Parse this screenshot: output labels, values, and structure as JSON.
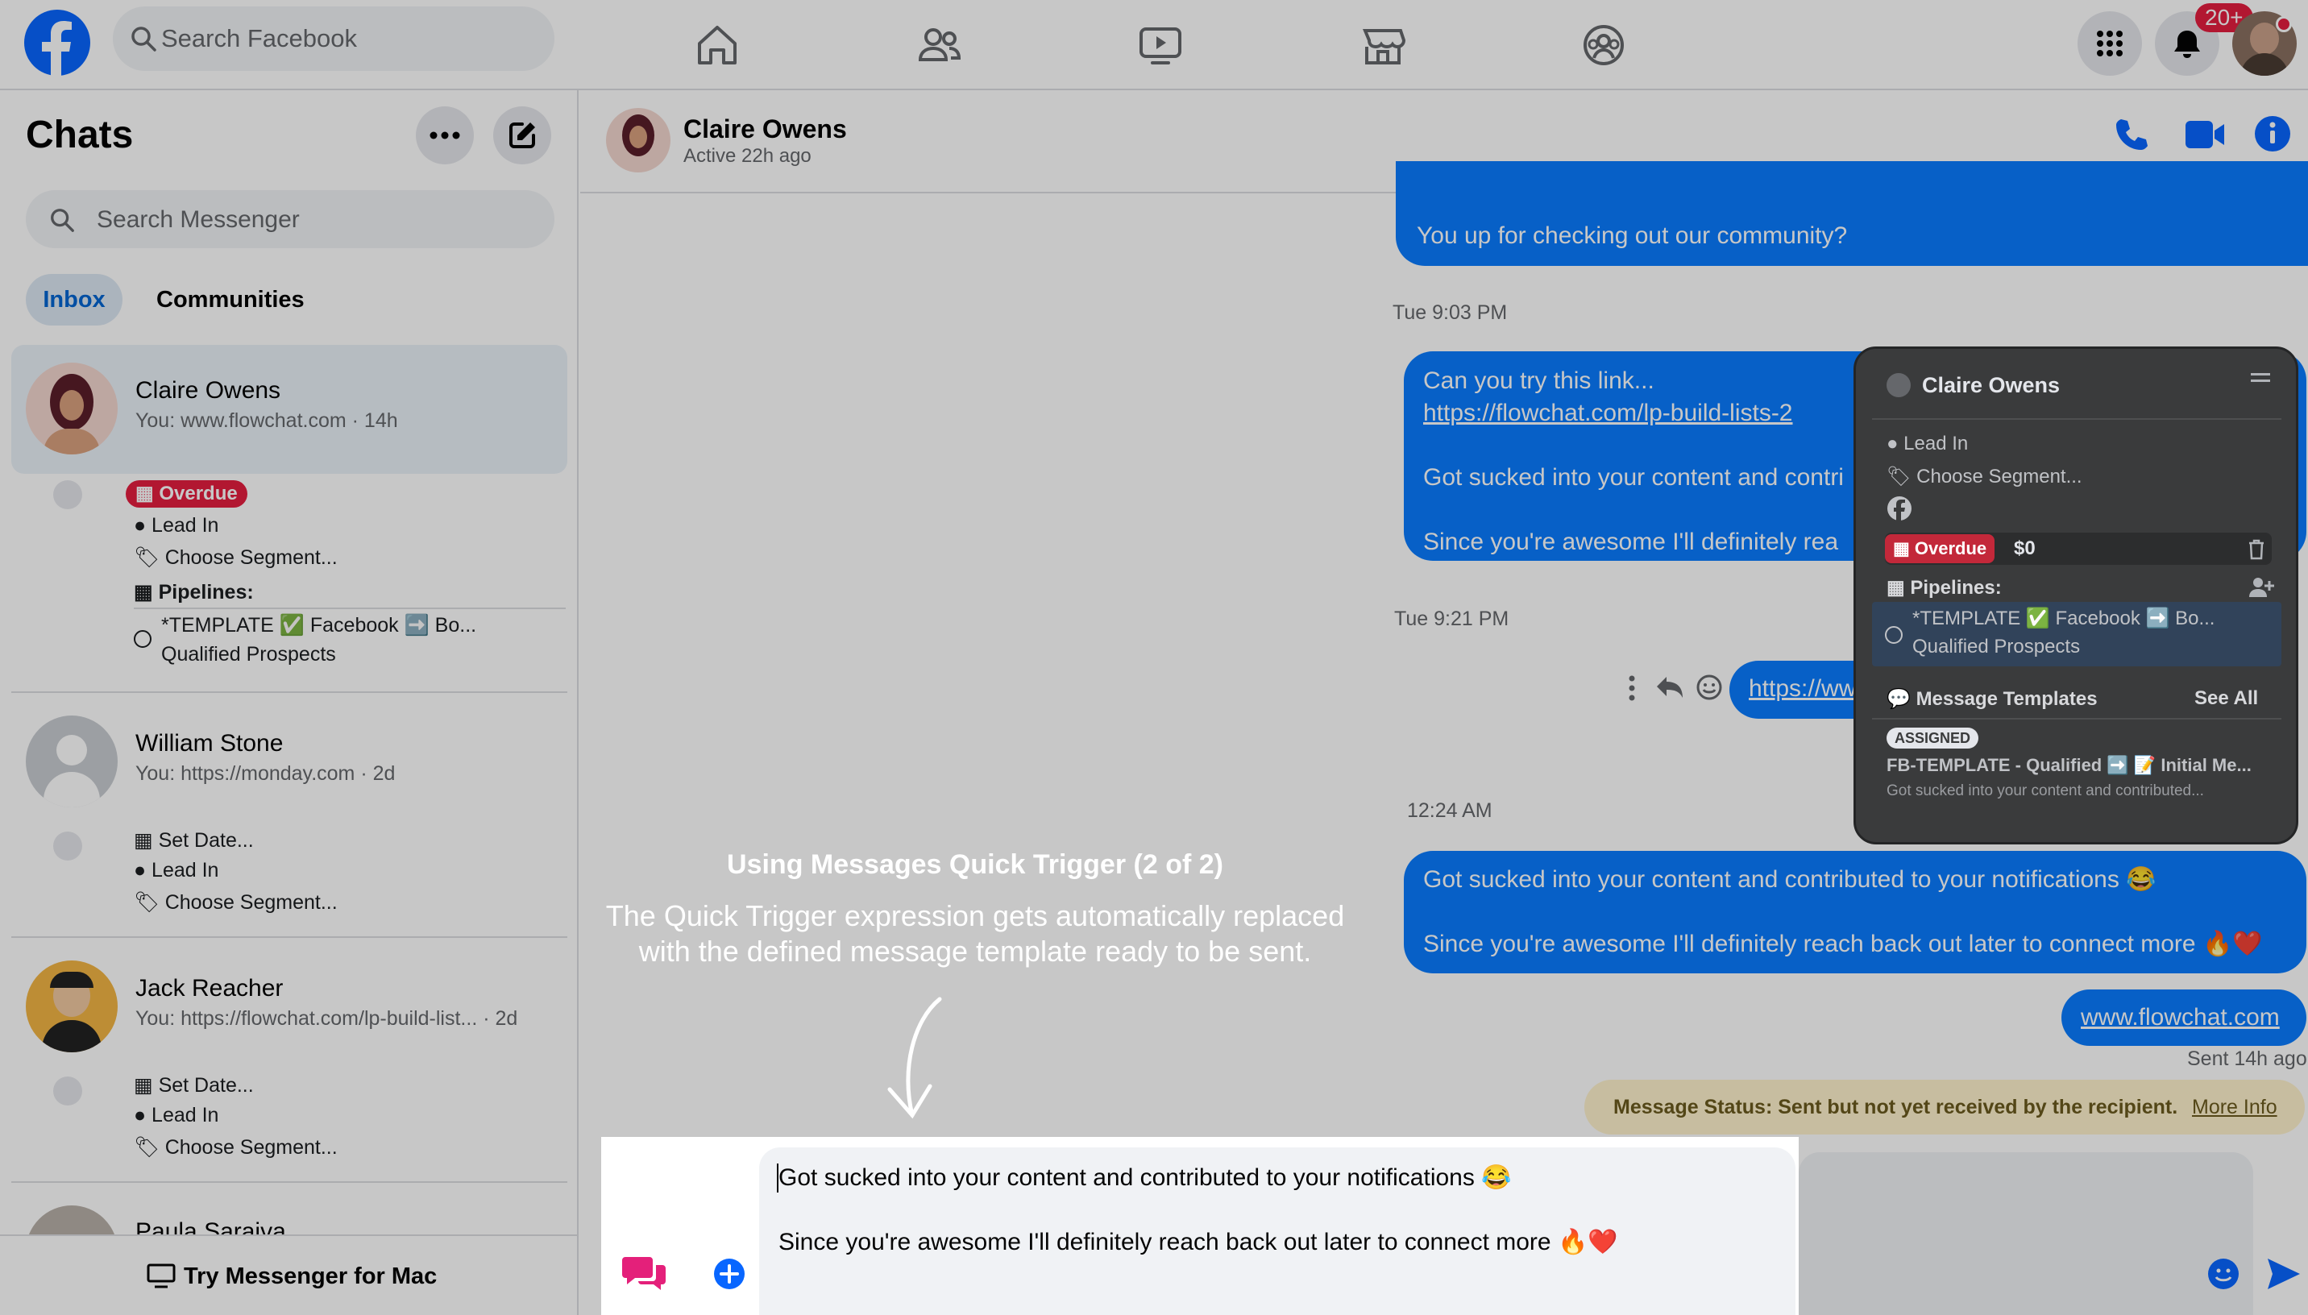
{
  "topbar": {
    "search_placeholder": "Search Facebook",
    "notif_badge": "20+",
    "icons": [
      "home-icon",
      "friends-icon",
      "watch-icon",
      "marketplace-icon",
      "groups-icon",
      "apps-menu-icon",
      "bell-icon"
    ]
  },
  "sidebar": {
    "title": "Chats",
    "search_placeholder": "Search Messenger",
    "tabs": [
      "Inbox",
      "Communities"
    ],
    "try_mac": "Try Messenger for Mac",
    "chats": [
      {
        "name": "Claire Owens",
        "preview": "You: www.flowchat.com · 14h",
        "badge": "Overdue",
        "lead": "Lead In",
        "segment": "Choose Segment...",
        "pipelines": "Pipelines:",
        "pipeline_line1": "*TEMPLATE ✅ Facebook ➡️ Bo...",
        "pipeline_line2": "Qualified Prospects"
      },
      {
        "name": "William Stone",
        "preview": "You: https://monday.com · 2d",
        "date": "Set Date...",
        "lead": "Lead In",
        "segment": "Choose Segment..."
      },
      {
        "name": "Jack Reacher",
        "preview": "You: https://flowchat.com/lp-build-list... · 2d",
        "date": "Set Date...",
        "lead": "Lead In",
        "segment": "Choose Segment..."
      },
      {
        "name": "Paula Saraiva"
      }
    ]
  },
  "header": {
    "name": "Claire Owens",
    "status": "Active 22h ago"
  },
  "messages": {
    "m1": "You up for checking out our community?",
    "ts1": "Tue 9:03 PM",
    "m2_line1": "Can you try this link...",
    "m2_link": "https://flowchat.com/lp-build-lists-2",
    "m2_line2": "Got sucked into your content and contri",
    "m2_line3": "Since you're awesome I'll definitely rea",
    "ts2": "Tue 9:21 PM",
    "m3_link": "https://ww",
    "ts3": "12:24 AM",
    "m4_line1": "Got sucked into your content and contributed to your notifications 😂",
    "m4_line2": "Since you're awesome I'll definitely reach back out later to connect more 🔥❤️",
    "m5_link": "www.flowchat.com",
    "sent": "Sent 14h ago",
    "status_text": "Message Status: Sent but not yet received by the recipient.",
    "status_link": "More Info"
  },
  "panel": {
    "name": "Claire Owens",
    "lead": "Lead In",
    "segment": "Choose Segment...",
    "badge": "Overdue",
    "amount": "$0",
    "pipelines": "Pipelines:",
    "pipeline_line1": "*TEMPLATE ✅ Facebook ➡️ Bo...",
    "pipeline_line2": "Qualified Prospects",
    "templates_title": "Message Templates",
    "see_all": "See All",
    "assigned": "ASSIGNED",
    "template_name": "FB-TEMPLATE - Qualified ➡️ 📝 Initial Me...",
    "template_preview": "Got sucked into your content and contributed..."
  },
  "composer": {
    "line1": "Got sucked into your content and contributed to your notifications 😂",
    "line2": "Since you're awesome I'll definitely reach back out later to connect more 🔥❤️"
  },
  "caption": {
    "title": "Using Messages Quick Trigger (2 of 2)",
    "line1": "The Quick Trigger expression gets automatically replaced",
    "line2": "with the defined message template ready to be sent."
  },
  "colors": {
    "accent": "#0866ff",
    "bubble": "#0a7cff",
    "overdue": "#e41e3f",
    "panel": "#3a3b3c"
  }
}
